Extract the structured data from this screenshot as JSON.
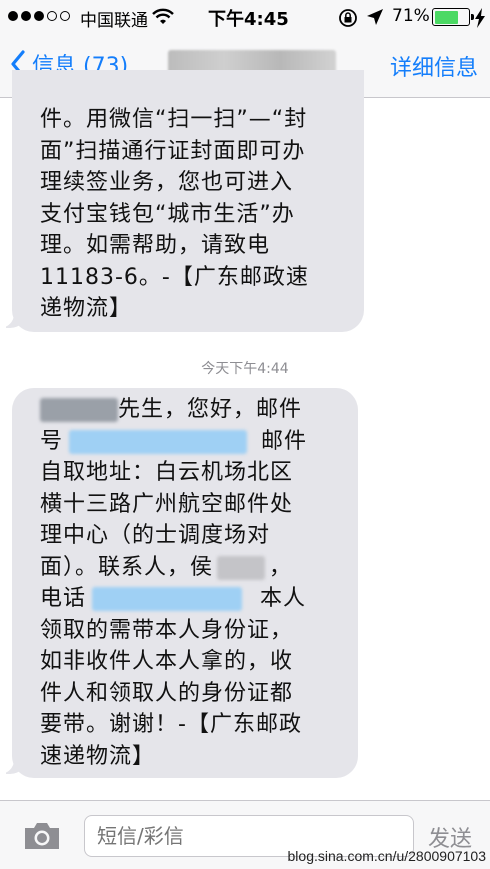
{
  "status_bar": {
    "signal_bars_filled": 3,
    "signal_bars_total": 5,
    "carrier": "中国联通",
    "time": "下午4:45",
    "battery_percent": "71%",
    "battery_level": 0.71,
    "icons": [
      "wifi-icon",
      "orientation-lock-icon",
      "location-arrow-icon",
      "battery-icon",
      "charging-icon"
    ]
  },
  "nav": {
    "back_label": "信息 (73)",
    "details_label": "详细信息"
  },
  "messages": [
    {
      "lines": [
        "件。用微信“扫一扫”—“封",
        "面”扫描通行证封面即可办",
        "理续签业务，您也可进入",
        "支付宝钱包“城市生活”办",
        "理。如需帮助，请致电",
        "11183-6。-【广东邮政速",
        "递物流】"
      ]
    },
    {
      "timestamp": "今天下午4:44",
      "lines": {
        "l1_after": "先生，您好，邮件",
        "l2_before": "号",
        "l2_after": "邮件",
        "l3": "自取地址：白云机场北区",
        "l4": "横十三路广州航空邮件处",
        "l5": "理中心（的士调度场对",
        "l6_before": "面）。联系人，侯",
        "l6_after": "，",
        "l7_before": "电话",
        "l7_after": "本人",
        "l8": "领取的需带本人身份证，",
        "l9": "如非收件人本人拿的，收",
        "l10": "件人和领取人的身份证都",
        "l11": "要带。谢谢！-【广东邮政",
        "l12": "速递物流】"
      }
    }
  ],
  "input": {
    "placeholder": "短信/彩信",
    "send_label": "发送"
  },
  "watermark": "blog.sina.com.cn/u/2800907103",
  "colors": {
    "accent": "#147efb",
    "bubble": "#e5e5ea",
    "battery": "#4cd964"
  }
}
